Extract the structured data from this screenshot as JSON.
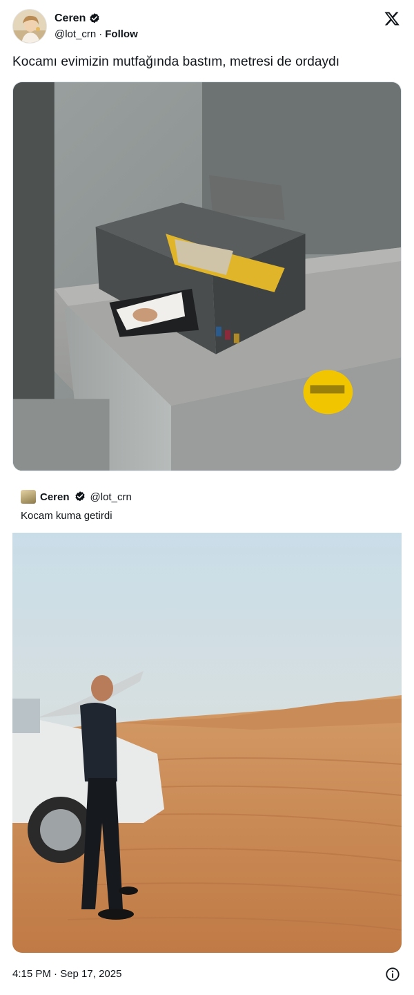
{
  "author": {
    "display_name": "Ceren",
    "handle": "@lot_crn",
    "follow_label": "Follow",
    "verified": true
  },
  "tweet": {
    "text": "Kocamı evimizin mutfağında bastım, metresi de ordaydı"
  },
  "quoted_tweet": {
    "display_name": "Ceren",
    "handle": "@lot_crn",
    "text": "Kocam kuma getirdi",
    "verified": true
  },
  "footer": {
    "timestamp": "4:15 PM · Sep 17, 2025"
  },
  "icons": {
    "platform": "x-logo-icon",
    "verified": "verified-badge-icon",
    "info": "info-icon"
  },
  "colors": {
    "text": "#0f1419",
    "badge": "#0f1419",
    "border": "#e1e8ed"
  }
}
